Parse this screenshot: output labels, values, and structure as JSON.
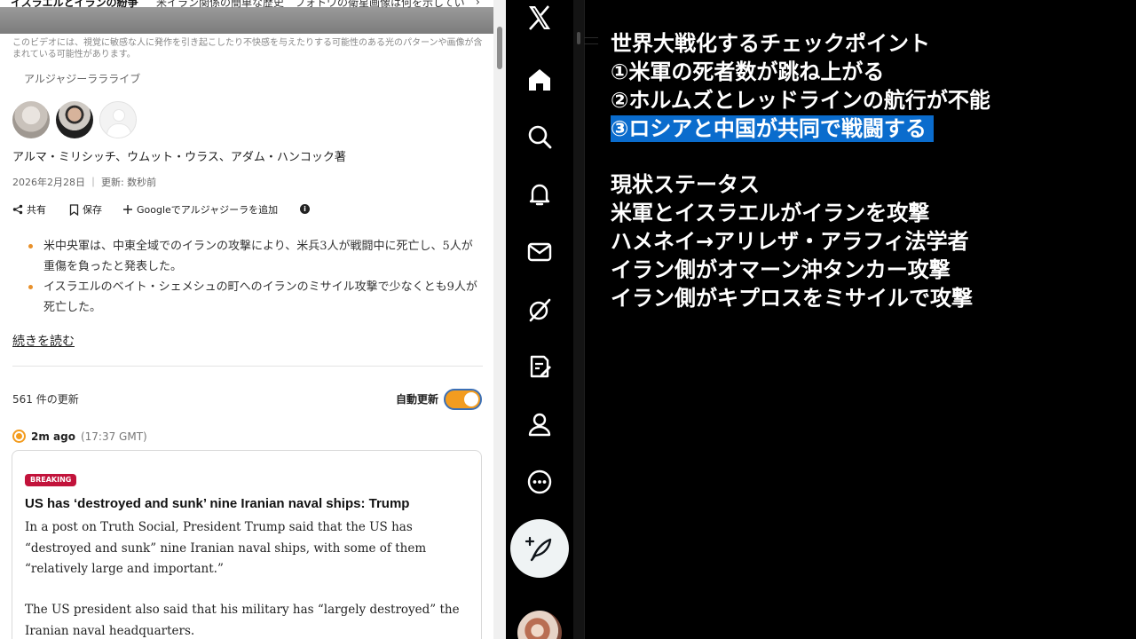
{
  "article": {
    "nav_tab_active": "イスラエルとイランの紛争",
    "nav_tab_next": "米イラン関係の簡単な歴史　フォトワの衛星画像は何を示してい",
    "warning_text": "このビデオには、視覚に敏感な人に発作を引き起こしたり不快感を与えたりする可能性のある光のパターンや画像が含まれている可能性があります。",
    "source_name": "アルジャジーララライブ",
    "authors": "アルマ・ミリシッチ、ウムット・ウラス、アダム・ハンコック著",
    "meta": "2026年2月28日 ｜ 更新: 数秒前",
    "actions": {
      "share": "共有",
      "save": "保存",
      "google": "Googleでアルジャジーラを追加"
    },
    "bullets": [
      "米中央軍は、中東全域でのイランの攻撃により、米兵3人が戦闘中に死亡し、5人が重傷を負ったと発表した。",
      "イスラエルのベイト・シェメシュの町へのイランのミサイル攻撃で少なくとも9人が死亡した。"
    ],
    "read_more": "続きを読む",
    "updates_count": "561 件の更新",
    "auto_update_label": "自動更新",
    "auto_update_on": true,
    "post": {
      "time_ago": "2m ago",
      "time_gmt": "(17:37 GMT)",
      "badge": "BREAKING",
      "headline": "US has ‘destroyed and sunk’ nine Iranian naval ships: Trump",
      "paragraph1": "In a post on Truth Social, President Trump said that the US has “destroyed and sunk” nine Iranian naval ships, with some of them “relatively large and important.”",
      "paragraph2": "The US president also said that his military has “largely destroyed” the Iranian naval headquarters."
    }
  },
  "x_sidebar": {
    "icons": [
      "x-logo-icon",
      "home-icon",
      "search-icon",
      "notifications-icon",
      "messages-icon",
      "grok-icon",
      "drafts-icon",
      "profile-icon",
      "more-icon"
    ],
    "compose_icon": "compose-post-icon"
  },
  "notes": {
    "lines": [
      "世界大戦化するチェックポイント",
      "①米軍の死者数が跳ね上がる",
      "②ホルムズとレッドラインの航行が不能",
      "③ロシアと中国が共同で戦闘する",
      "現状ステータス",
      "米軍とイスラエルがイランを攻撃",
      "ハメネイ→アリレザ・アラフィ法学者",
      "イラン側がオマーン沖タンカー攻撃",
      "イラン側がキプロスをミサイルで攻撃"
    ],
    "selected_line_index": 3
  },
  "colors": {
    "accent_orange": "#f39c1f",
    "breaking_red": "#c2133b",
    "selection_blue": "#0a6ccd"
  }
}
